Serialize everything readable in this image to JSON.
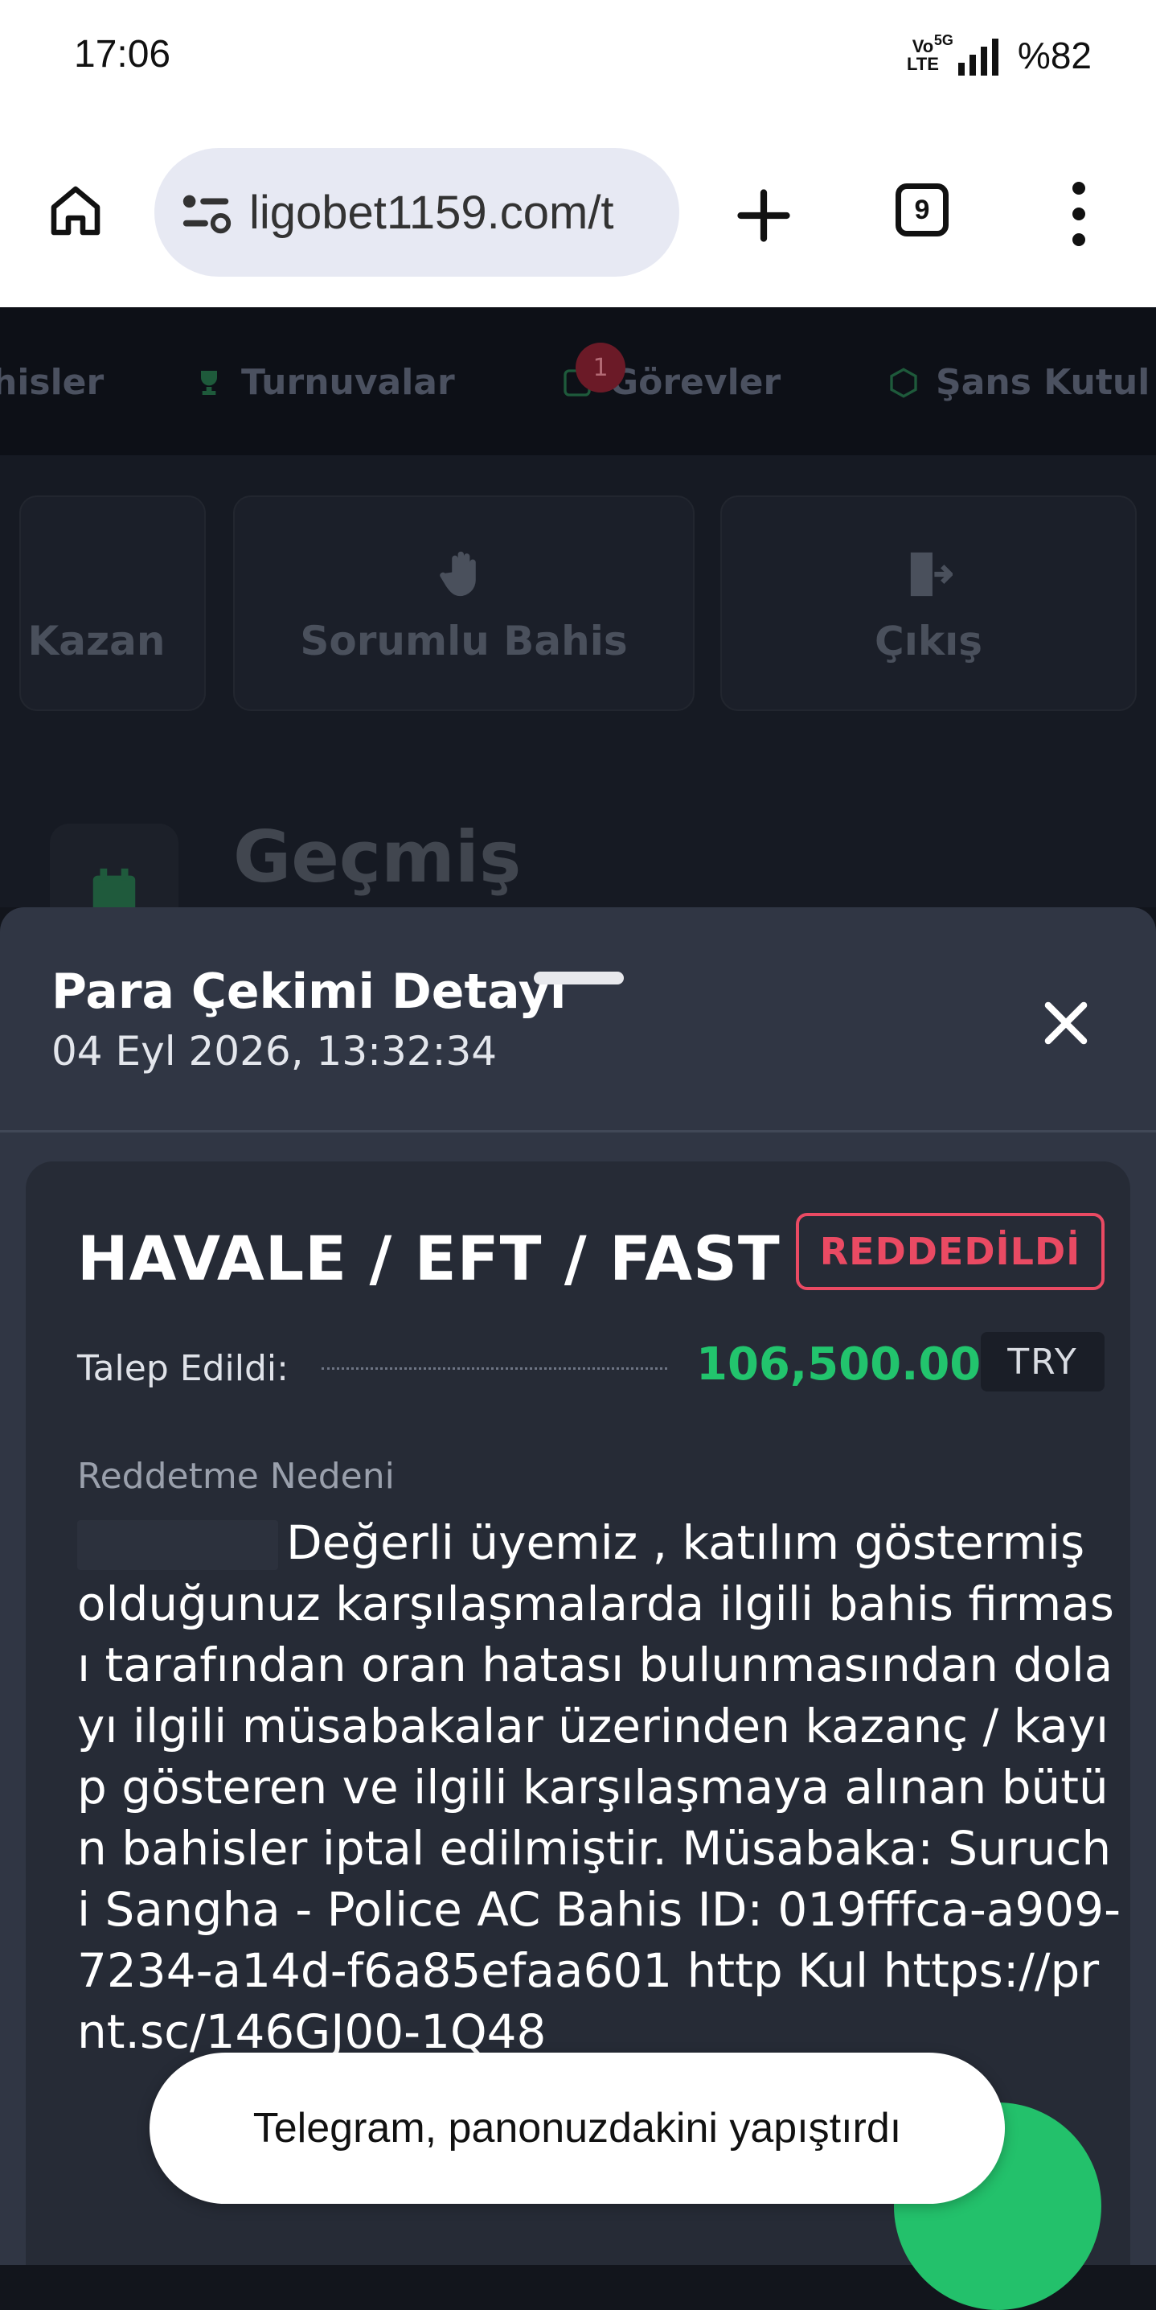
{
  "status_bar": {
    "time": "17:06",
    "volte_top": "Vo",
    "volte_bottom": "LTE",
    "network": "5G",
    "battery": "%82"
  },
  "browser": {
    "url": "ligobet1159.com/t",
    "tab_count": "9"
  },
  "site_nav": {
    "items": [
      "hisler",
      "Turnuvalar",
      "Görevler",
      "Şans Kutul"
    ],
    "badge_count": "1"
  },
  "quick_links": [
    "Kazan",
    "Sorumlu Bahis",
    "Çıkış"
  ],
  "section_title": "Geçmiş",
  "modal": {
    "title": "Para Çekimi Detayı",
    "date": "04 Eyl 2026, 13:32:34",
    "method": "HAVALE / EFT / FAST",
    "status": "REDDEDİLDİ",
    "requested_label": "Talep Edildi:",
    "amount": "106,500.00",
    "currency": "TRY",
    "reason_label": "Reddetme Nedeni",
    "reason_text": "Değerli üyemiz , katılım göstermiş olduğunuz karşılaşmalarda ilgili bahis firması tarafından oran hatası bulunmasından dolayı ilgili müsabakalar üzerinden kazanç / kayıp gösteren ve ilgili karşılaşmaya alınan bütün bahisler iptal edilmiştir. Müsabaka: Suruchi Sangha - Police AC Bahis ID: 019fffca-a909-7234-a14d-f6a85efaa601 http Kul https://prnt.sc/146GJ00-1Q48"
  },
  "toast": "Telegram, panonuzdakini yapıştırdı",
  "colors": {
    "accent_green": "#22c46d",
    "rejected_red": "#ea4a63",
    "sheet_bg": "#303644",
    "card_bg": "#262b36"
  }
}
